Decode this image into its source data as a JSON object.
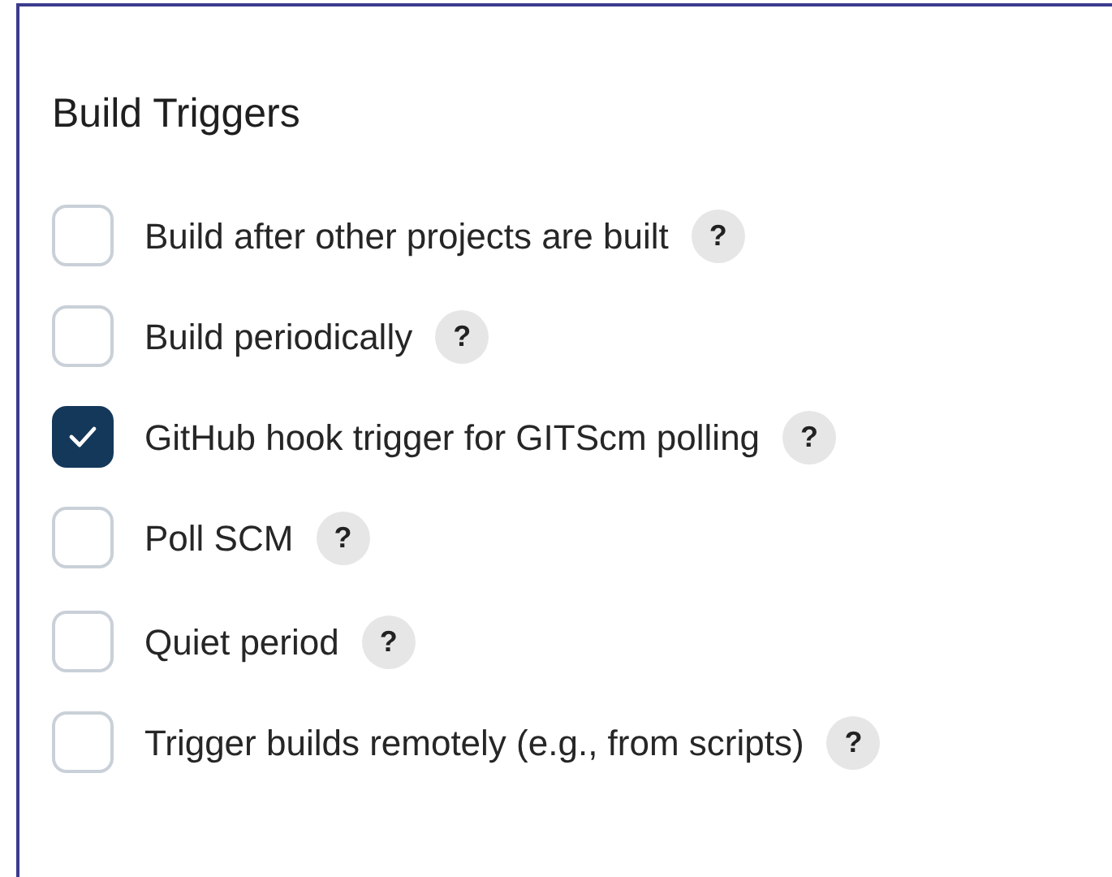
{
  "section": {
    "title": "Build Triggers"
  },
  "groups": [
    {
      "items": [
        {
          "label": "Build after other projects are built",
          "checked": false,
          "help": "?"
        },
        {
          "label": "Build periodically",
          "checked": false,
          "help": "?"
        },
        {
          "label": "GitHub hook trigger for GITScm polling",
          "checked": true,
          "help": "?"
        },
        {
          "label": "Poll SCM",
          "checked": false,
          "help": "?"
        }
      ]
    },
    {
      "items": [
        {
          "label": "Quiet period",
          "checked": false,
          "help": "?"
        },
        {
          "label": "Trigger builds remotely (e.g., from scripts)",
          "checked": false,
          "help": "?"
        }
      ]
    }
  ]
}
